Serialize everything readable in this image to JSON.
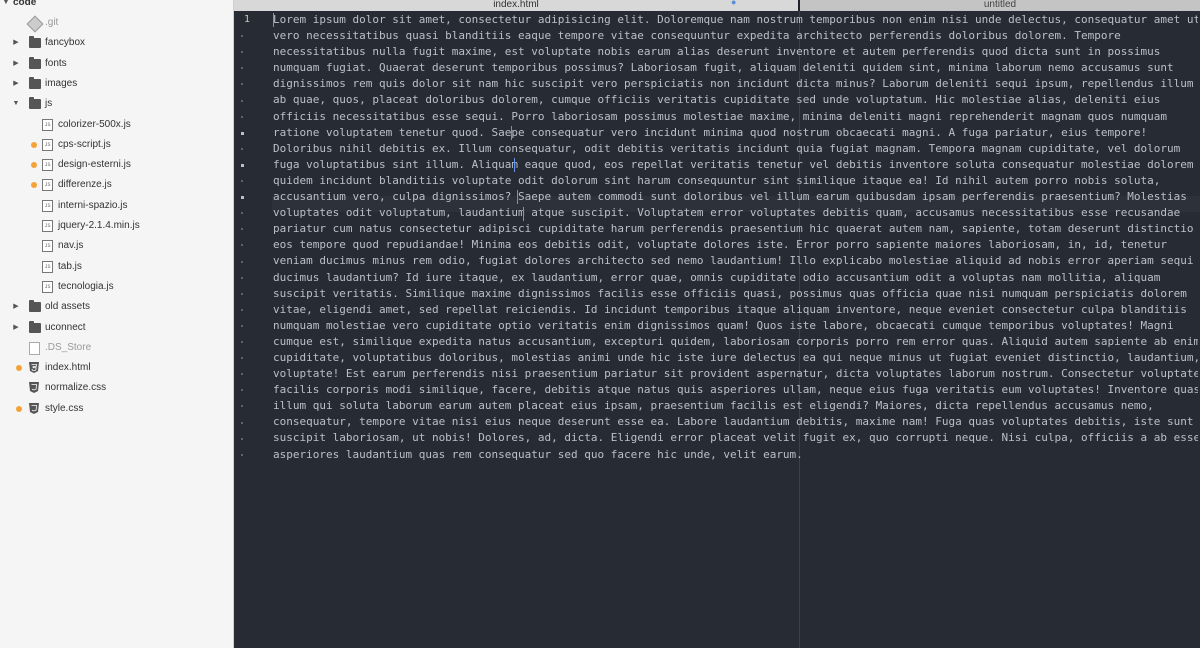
{
  "sidebar": {
    "root": "code",
    "items": [
      {
        "label": ".git",
        "type": "git",
        "depth": 1,
        "modified": false
      },
      {
        "label": "fancybox",
        "type": "folder",
        "depth": 1,
        "collapsed": true
      },
      {
        "label": "fonts",
        "type": "folder",
        "depth": 1,
        "collapsed": true
      },
      {
        "label": "images",
        "type": "folder",
        "depth": 1,
        "collapsed": true
      },
      {
        "label": "js",
        "type": "folder",
        "depth": 1,
        "collapsed": false
      },
      {
        "label": "colorizer-500x.js",
        "type": "js",
        "depth": 2,
        "modified": false
      },
      {
        "label": "cps-script.js",
        "type": "js",
        "depth": 2,
        "modified": true
      },
      {
        "label": "design-esterni.js",
        "type": "js",
        "depth": 2,
        "modified": true
      },
      {
        "label": "differenze.js",
        "type": "js",
        "depth": 2,
        "modified": true
      },
      {
        "label": "interni-spazio.js",
        "type": "js",
        "depth": 2,
        "modified": false
      },
      {
        "label": "jquery-2.1.4.min.js",
        "type": "js",
        "depth": 2,
        "modified": false
      },
      {
        "label": "nav.js",
        "type": "js",
        "depth": 2,
        "modified": false
      },
      {
        "label": "tab.js",
        "type": "js",
        "depth": 2,
        "modified": false
      },
      {
        "label": "tecnologia.js",
        "type": "js",
        "depth": 2,
        "modified": false
      },
      {
        "label": "old assets",
        "type": "folder",
        "depth": 1,
        "collapsed": true
      },
      {
        "label": "uconnect",
        "type": "folder",
        "depth": 1,
        "collapsed": true
      },
      {
        "label": ".DS_Store",
        "type": "file",
        "depth": 1,
        "modified": false
      },
      {
        "label": "index.html",
        "type": "html",
        "depth": 1,
        "modified": true
      },
      {
        "label": "normalize.css",
        "type": "css",
        "depth": 1,
        "modified": false
      },
      {
        "label": "style.css",
        "type": "css",
        "depth": 1,
        "modified": true
      }
    ]
  },
  "tabs": [
    {
      "label": "index.html",
      "active": true
    },
    {
      "label": "untitled",
      "active": false
    }
  ],
  "editor": {
    "line_number": "1",
    "lines": [
      "Lorem ipsum dolor sit amet, consectetur adipisicing elit. Doloremque nam nostrum temporibus non enim nisi unde delectus, consequatur amet ut",
      "vero necessitatibus quasi blanditiis eaque tempore vitae consequuntur expedita architecto perferendis doloribus dolorem. Tempore",
      "necessitatibus nulla fugit maxime, est voluptate nobis earum alias deserunt inventore et autem perferendis quod dicta sunt in possimus",
      "numquam fugiat. Quaerat deserunt temporibus possimus? Laboriosam fugit, aliquam deleniti quidem sint, minima laborum nemo accusamus sunt",
      "dignissimos rem quis dolor sit nam hic suscipit vero perspiciatis non incidunt dicta minus? Laborum deleniti sequi ipsum, repellendus illum",
      "ab quae, quos, placeat doloribus dolorem, cumque officiis veritatis cupiditate sed unde voluptatum. Hic molestiae alias, deleniti eius",
      "officiis necessitatibus esse sequi. Porro laboriosam possimus molestiae maxime, minima deleniti magni reprehenderit magnam quos numquam",
      "ratione voluptatem tenetur quod. Saepe consequatur vero incidunt minima quod nostrum obcaecati magni. A fuga pariatur, eius tempore!",
      "Doloribus nihil debitis ex. Illum consequatur, odit debitis veritatis incidunt quia fugiat magnam. Tempora magnam cupiditate, vel dolorum",
      "fuga voluptatibus sint illum. Aliquam eaque quod, eos repellat veritatis tenetur vel debitis inventore soluta consequatur molestiae dolorem",
      "quidem incidunt blanditiis voluptate odit dolorum sint harum consequuntur sint similique itaque ea! Id nihil autem porro nobis soluta,",
      "accusantium vero, culpa dignissimos? Saepe autem commodi sunt doloribus vel illum earum quibusdam ipsam perferendis praesentium? Molestias",
      "voluptates odit voluptatum, laudantium atque suscipit. Voluptatem error voluptates debitis quam, accusamus necessitatibus esse recusandae",
      "pariatur cum natus consectetur adipisci cupiditate harum perferendis praesentium hic quaerat autem nam, sapiente, totam deserunt distinctio",
      "eos tempore quod repudiandae! Minima eos debitis odit, voluptate dolores iste. Error porro sapiente maiores laboriosam, in, id, tenetur",
      "veniam ducimus minus rem odio, fugiat dolores architecto sed nemo laudantium! Illo explicabo molestiae aliquid ad nobis error aperiam sequi",
      "ducimus laudantium? Id iure itaque, ex laudantium, error quae, omnis cupiditate odio accusantium odit a voluptas nam mollitia, aliquam",
      "suscipit veritatis. Similique maxime dignissimos facilis esse officiis quasi, possimus quas officia quae nisi numquam perspiciatis dolorem",
      "vitae, eligendi amet, sed repellat reiciendis. Id incidunt temporibus itaque aliquam inventore, neque eveniet consectetur culpa blanditiis",
      "numquam molestiae vero cupiditate optio veritatis enim dignissimos quam! Quos iste labore, obcaecati cumque temporibus voluptates! Magni",
      "cumque est, similique expedita natus accusantium, excepturi quidem, laboriosam corporis porro rem error quas. Aliquid autem sapiente ab enim",
      "cupiditate, voluptatibus doloribus, molestias animi unde hic iste iure delectus ea qui neque minus ut fugiat eveniet distinctio, laudantium,",
      "voluptate! Est earum perferendis nisi praesentium pariatur sit provident aspernatur, dicta voluptates laborum nostrum. Consectetur voluptate",
      "facilis corporis modi similique, facere, debitis atque natus quis asperiores ullam, neque eius fuga veritatis eum voluptates! Inventore quasi",
      "illum qui soluta laborum earum autem placeat eius ipsam, praesentium facilis est eligendi? Maiores, dicta repellendus accusamus nemo,",
      "consequatur, tempore vitae nisi eius neque deserunt esse ea. Labore laudantium debitis, maxime nam! Fuga quas voluptates debitis, iste sunt",
      "suscipit laboriosam, ut nobis! Dolores, ad, dicta. Eligendi error placeat velit fugit ex, quo corrupti neque. Nisi culpa, officiis a ab esse,",
      "asperiores laudantium quas rem consequatur sed quo facere hic unde, velit earum."
    ]
  },
  "colors": {
    "editor_bg": "#272b33",
    "editor_text": "#b9c0cb",
    "sidebar_bg": "#f5f5f5",
    "modified_dot": "#f3a33a",
    "cursor": "#6494ed"
  }
}
